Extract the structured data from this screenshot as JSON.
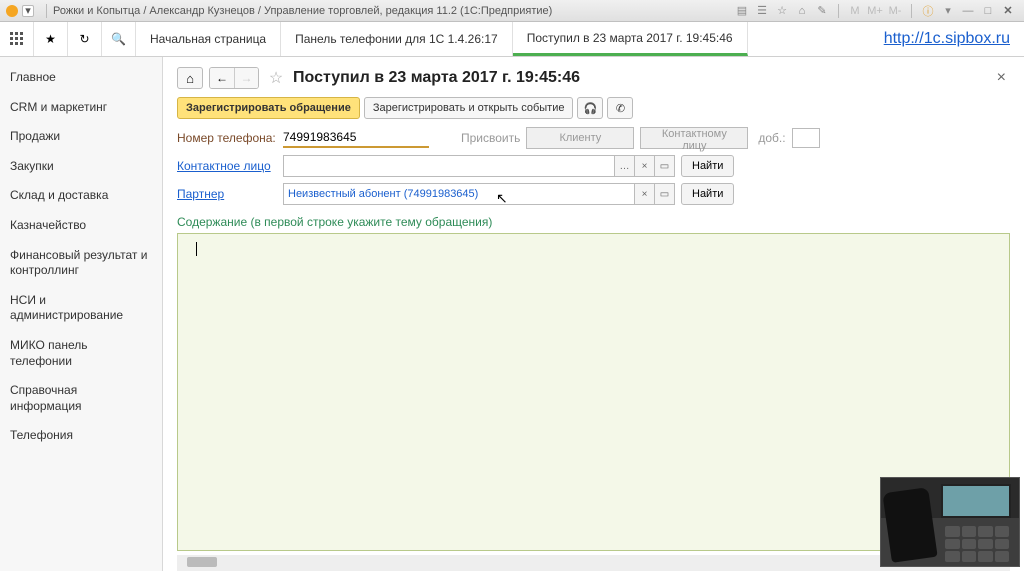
{
  "titlebar": {
    "text": "Рожки и Копытца / Александр Кузнецов / Управление торговлей, редакция 11.2  (1С:Предприятие)"
  },
  "topstrip": {
    "tabs": [
      "Начальная страница",
      "Панель телефонии для 1С 1.4.26:17",
      "Поступил в 23 марта 2017 г. 19:45:46"
    ],
    "active_tab_index": 2,
    "link": "http://1c.sipbox.ru"
  },
  "sidebar": {
    "items": [
      "Главное",
      "CRM и маркетинг",
      "Продажи",
      "Закупки",
      "Склад и доставка",
      "Казначейство",
      "Финансовый результат и контроллинг",
      "НСИ и администрирование",
      "МИКО панель телефонии",
      "Справочная информация",
      "Телефония"
    ]
  },
  "page": {
    "title": "Поступил в 23 марта 2017 г. 19:45:46",
    "toolbar": {
      "register_request": "Зарегистрировать обращение",
      "register_open_event": "Зарегистрировать и открыть событие"
    },
    "form": {
      "phone_label": "Номер телефона:",
      "phone_value": "74991983645",
      "assign_label": "Присвоить",
      "to_client": "Клиенту",
      "to_contact": "Контактному лицу",
      "ext_label": "доб.:",
      "contact_label": "Контактное лицо",
      "contact_value": "",
      "partner_label": "Партнер",
      "partner_value": "Неизвестный абонент (74991983645)",
      "find": "Найти"
    },
    "content_label": "Содержание (в первой строке укажите тему обращения)"
  }
}
